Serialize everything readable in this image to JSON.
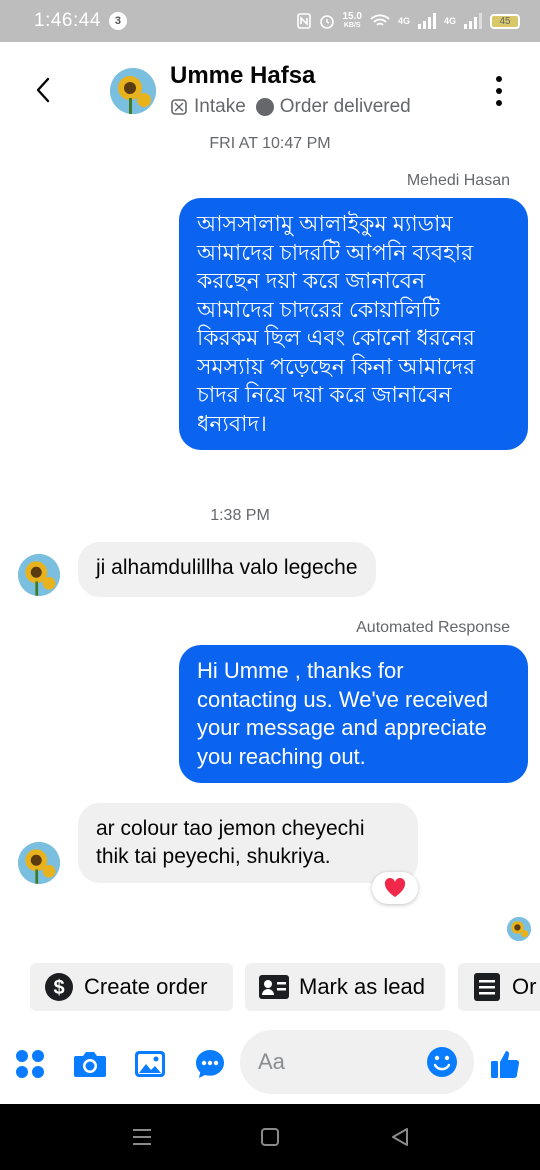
{
  "status_bar": {
    "time": "1:46:44",
    "notification_count": "3",
    "net_speed_value": "15.0",
    "net_speed_unit": "KB/S",
    "network_1": "4G",
    "network_2": "4G",
    "battery": "45"
  },
  "header": {
    "contact_name": "Umme Hafsa",
    "intake_label": "Intake",
    "status_label": "Order delivered"
  },
  "conversation": {
    "timestamp_1": "FRI AT 10:47 PM",
    "sender_1": "Mehedi Hasan",
    "outgoing_1_lines": [
      "আসসালামু আলাইকুম ম্যাডাম",
      "আমাদের চাদরটি আপনি ব্যবহার",
      "করছেন দয়া করে জানাবেন",
      "আমাদের চাদরের কোয়ালিটি",
      "কিরকম ছিল এবং কোনো ধরনের",
      "সমস্যায় পড়েছেন কিনা আমাদের",
      "চাদর নিয়ে দয়া করে জানাবেন",
      "ধন্যবাদ।"
    ],
    "timestamp_2": "1:38 PM",
    "incoming_1": "ji alhamdulillha valo legeche",
    "sender_2": "Automated Response",
    "outgoing_2_lines": [
      "Hi Umme , thanks for",
      "contacting us. We've received",
      "your message and appreciate",
      "you reaching out."
    ],
    "incoming_2_lines": [
      "ar colour tao jemon cheyechi",
      "thik tai peyechi, shukriya."
    ],
    "reaction_icon": "heart-icon",
    "reaction_color": "#f02849"
  },
  "actions": {
    "create_order": "Create order",
    "mark_as_lead": "Mark as lead",
    "orders_partial": "Or"
  },
  "composer": {
    "placeholder": "Aa"
  },
  "colors": {
    "accent": "#0a64f0",
    "status_bar_bg": "#bdbdbd",
    "incoming_bubble": "#f0f0f0",
    "messenger_icon": "#0a7cff"
  }
}
